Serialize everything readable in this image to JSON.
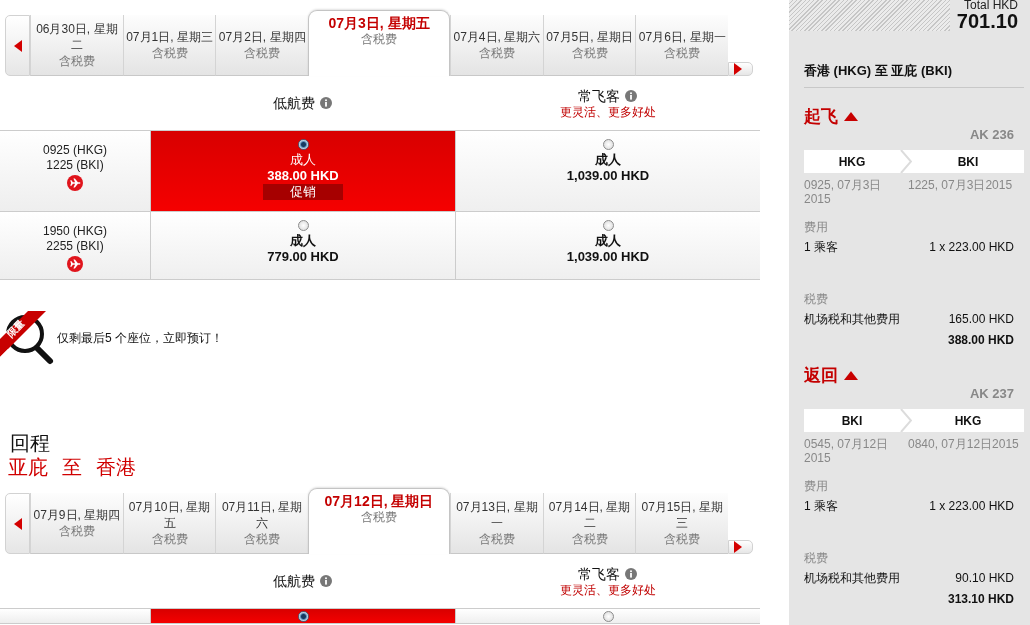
{
  "outbound": {
    "date_tabs": [
      {
        "date": "06月30日, 星期二",
        "note": "含税费",
        "selected": false
      },
      {
        "date": "07月1日, 星期三",
        "note": "含税费",
        "selected": false
      },
      {
        "date": "07月2日, 星期四",
        "note": "含税费",
        "selected": false
      },
      {
        "date": "07月3日, 星期五",
        "note": "含税费",
        "selected": true
      },
      {
        "date": "07月4日, 星期六",
        "note": "含税费",
        "selected": false
      },
      {
        "date": "07月5日, 星期日",
        "note": "含税费",
        "selected": false
      },
      {
        "date": "07月6日, 星期一",
        "note": "含税费",
        "selected": false
      }
    ],
    "fare_headers": [
      {
        "name": "低航费"
      },
      {
        "name": "常飞客",
        "subtitle": "更灵活、更多好处"
      }
    ],
    "flights": [
      {
        "depart": "0925 (HKG)",
        "arrive": "1225 (BKI)",
        "fares": [
          {
            "passenger": "成人",
            "price": "388.00 HKD",
            "badge": "促销",
            "selected": true
          },
          {
            "passenger": "成人",
            "price": "1,039.00 HKD",
            "selected": false
          }
        ]
      },
      {
        "depart": "1950 (HKG)",
        "arrive": "2255 (BKI)",
        "fares": [
          {
            "passenger": "成人",
            "price": "779.00 HKD",
            "selected": false
          },
          {
            "passenger": "成人",
            "price": "1,039.00 HKD",
            "selected": false
          }
        ]
      }
    ]
  },
  "notice": {
    "badge": "限量",
    "text": "仅剩最后5 个座位，立即预订！"
  },
  "return": {
    "title": "回程",
    "route": {
      "from": "亚庇",
      "connector": "至",
      "to": "香港"
    },
    "date_tabs": [
      {
        "date": "07月9日, 星期四",
        "note": "含税费",
        "selected": false
      },
      {
        "date": "07月10日, 星期五",
        "note": "含税费",
        "selected": false
      },
      {
        "date": "07月11日, 星期六",
        "note": "含税费",
        "selected": false
      },
      {
        "date": "07月12日, 星期日",
        "note": "含税费",
        "selected": true
      },
      {
        "date": "07月13日, 星期一",
        "note": "含税费",
        "selected": false
      },
      {
        "date": "07月14日, 星期二",
        "note": "含税费",
        "selected": false
      },
      {
        "date": "07月15日, 星期三",
        "note": "含税费",
        "selected": false
      }
    ],
    "fare_headers": [
      {
        "name": "低航费"
      },
      {
        "name": "常飞客",
        "subtitle": "更灵活、更多好处"
      }
    ],
    "flights": [
      {
        "fares": [
          {
            "selected": true
          },
          {
            "selected": false
          }
        ]
      }
    ]
  },
  "summary": {
    "total_label": "Total HKD",
    "total": "701.10",
    "route": "香港 (HKG) 至 亚庇 (BKI)",
    "legs": [
      {
        "title": "起飞",
        "expanded": true,
        "flight": "AK 236",
        "from": "HKG",
        "to": "BKI",
        "depart": "0925, 07月3日2015",
        "arrive": "1225, 07月3日2015",
        "fare_label": "费用",
        "passengers": "1 乘客",
        "fare": "1 x 223.00 HKD",
        "tax_label": "税费",
        "tax_name": "机场税和其他费用",
        "tax": "165.00 HKD",
        "subtotal": "388.00 HKD"
      },
      {
        "title": "返回",
        "expanded": true,
        "flight": "AK 237",
        "from": "BKI",
        "to": "HKG",
        "depart": "0545, 07月12日2015",
        "arrive": "0840, 07月12日2015",
        "fare_label": "费用",
        "passengers": "1 乘客",
        "fare": "1 x 223.00 HKD",
        "tax_label": "税费",
        "tax_name": "机场税和其他费用",
        "tax": "90.10 HKD",
        "subtotal": "313.10 HKD"
      }
    ]
  }
}
